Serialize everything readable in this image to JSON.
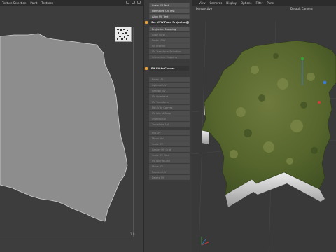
{
  "uv_editor": {
    "menu": [
      "Texture Selection",
      "Paint",
      "Textures"
    ],
    "corner_label": "1.0"
  },
  "tools": {
    "group1": [
      "Scale UV Test",
      "Normalize UV Test",
      "Align UV Test"
    ],
    "section_project": "Set UVW From Projection...",
    "group2": [
      "Projection Mapping",
      "Copy UVW",
      "Paste UVW",
      "Fill Inverse",
      "UV Transform Selection",
      "Interactive Mapping"
    ],
    "section_fit": "Fit UV to Canvas",
    "group3": [
      "Relax UV",
      "Optimal UV",
      "Realign UV",
      "UV Quadrant",
      "UV Transform",
      "Fit UV to Canvas",
      "UV Island Snap",
      "Unwrap UV",
      "Transform UV",
      "Rotate 90 CCW",
      "Rotate 90 CW"
    ],
    "group4": [
      "Flip UV",
      "Mirror UV",
      "Scale UV",
      "Center UV Grid",
      "Scale UV Grid",
      "UV Island Grid",
      "Move UV",
      "Reorder UV",
      "Delete UV"
    ]
  },
  "viewport": {
    "menu": [
      "View",
      "Cameras",
      "Display",
      "Options",
      "Filter",
      "Panel"
    ],
    "camera_label": "Perspective",
    "camera_select": "Default Camera"
  },
  "colors": {
    "accent": "#f0a030",
    "uv_shape": "#8c8c8c",
    "terrain_green": "#5a6e32",
    "terrain_side": "#d8d8d8"
  }
}
